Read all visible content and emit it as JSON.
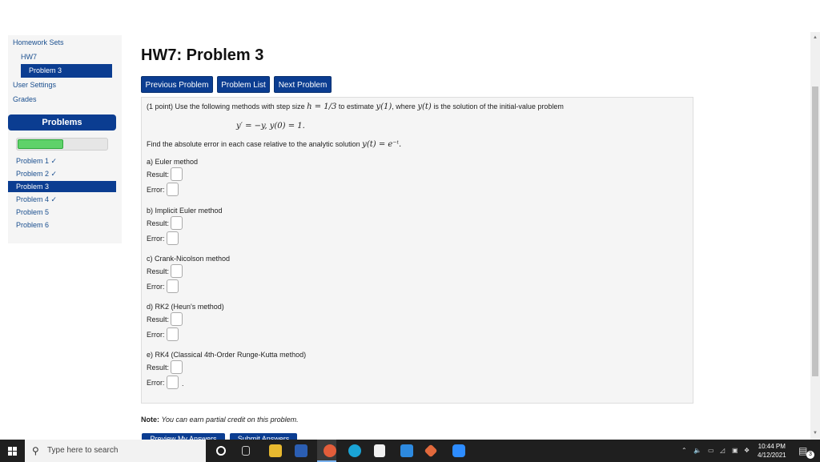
{
  "sidebar": {
    "homework_sets": "Homework Sets",
    "hw": "HW7",
    "problem_active": "Problem 3",
    "user_settings": "User Settings",
    "grades": "Grades",
    "problems_header": "Problems",
    "progress_fraction": 0.5,
    "problems": [
      {
        "label": "Problem 1 ✓"
      },
      {
        "label": "Problem 2 ✓"
      },
      {
        "label": "Problem 3"
      },
      {
        "label": "Problem 4 ✓"
      },
      {
        "label": "Problem 5"
      },
      {
        "label": "Problem 6"
      }
    ]
  },
  "main": {
    "title": "HW7: Problem 3",
    "buttons": {
      "prev": "Previous Problem",
      "list": "Problem List",
      "next": "Next Problem"
    },
    "intro_a": "(1 point) Use the following methods with step size",
    "intro_h": "h = 1/3",
    "intro_b": "to estimate",
    "intro_y1": "y(1)",
    "intro_c": ", where",
    "intro_yt": "y(t)",
    "intro_d": "is the solution of the initial-value problem",
    "equation": "y′ = −y,   y(0) = 1.",
    "find_a": "Find the absolute error in each case relative to the analytic solution",
    "find_sol": "y(t) = e⁻ᵗ.",
    "parts": [
      {
        "title": "a) Euler method"
      },
      {
        "title": "b) Implicit Euler method"
      },
      {
        "title": "c) Crank-Nicolson method"
      },
      {
        "title": "d) RK2 (Heun's method)"
      },
      {
        "title": "e) RK4 (Classical 4th-Order Runge-Kutta method)"
      }
    ],
    "result_label": "Result:",
    "error_label": "Error:",
    "trailing_period": ".",
    "note_label": "Note:",
    "note_text": "You can earn partial credit on this problem.",
    "preview_btn": "Preview My Answers",
    "submit_btn": "Submit Answers"
  },
  "taskbar": {
    "search_placeholder": "Type here to search",
    "time": "10:44 PM",
    "date": "4/12/2021",
    "notification_count": "3"
  },
  "colors": {
    "accent": "#0b3d91",
    "link": "#1a4f8f",
    "progress": "#5fd26a"
  }
}
